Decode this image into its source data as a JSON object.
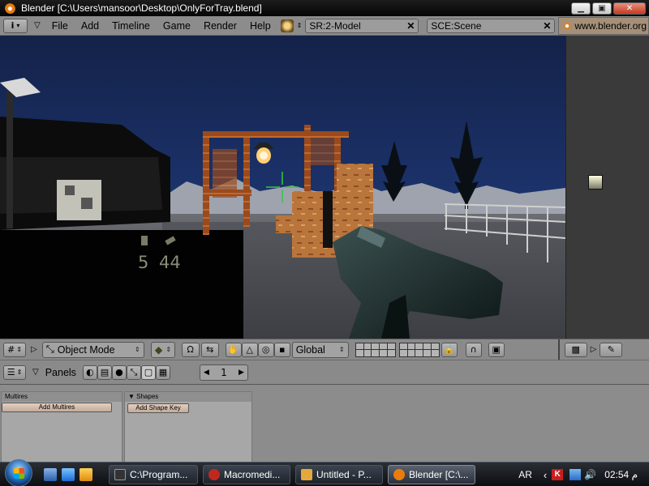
{
  "window": {
    "title": "Blender [C:\\Users\\mansoor\\Desktop\\OnlyForTray.blend]",
    "buttons": {
      "minimize": "▁",
      "maximize": "▣",
      "close": "✕"
    }
  },
  "header": {
    "menus": [
      "File",
      "Add",
      "Timeline",
      "Game",
      "Render",
      "Help"
    ],
    "screen_field": "SR:2-Model",
    "scene_field": "SCE:Scene",
    "url_label": "www.blender.org"
  },
  "viewport": {
    "hud": {
      "count_left": "5",
      "count_right": "44"
    },
    "crosshair_color": "#36c840"
  },
  "view_toolbar": {
    "mode": "Object Mode",
    "orientation": "Global"
  },
  "buttons_window": {
    "label": "Panels",
    "frame": "1",
    "panels": [
      {
        "title": "Multires",
        "button": "Add Multires"
      },
      {
        "title": "Shapes",
        "button": "Add Shape Key"
      }
    ]
  },
  "taskbar": {
    "items": [
      {
        "label": "C:\\Program...",
        "icon_color": "#333333"
      },
      {
        "label": "Macromedi...",
        "icon_color": "#c0281f"
      },
      {
        "label": "Untitled - P...",
        "icon_color": "#e5a93b"
      },
      {
        "label": "Blender [C:\\...",
        "icon_color": "#e87d0d"
      }
    ],
    "lang": "AR",
    "clock": "02:54 م"
  }
}
